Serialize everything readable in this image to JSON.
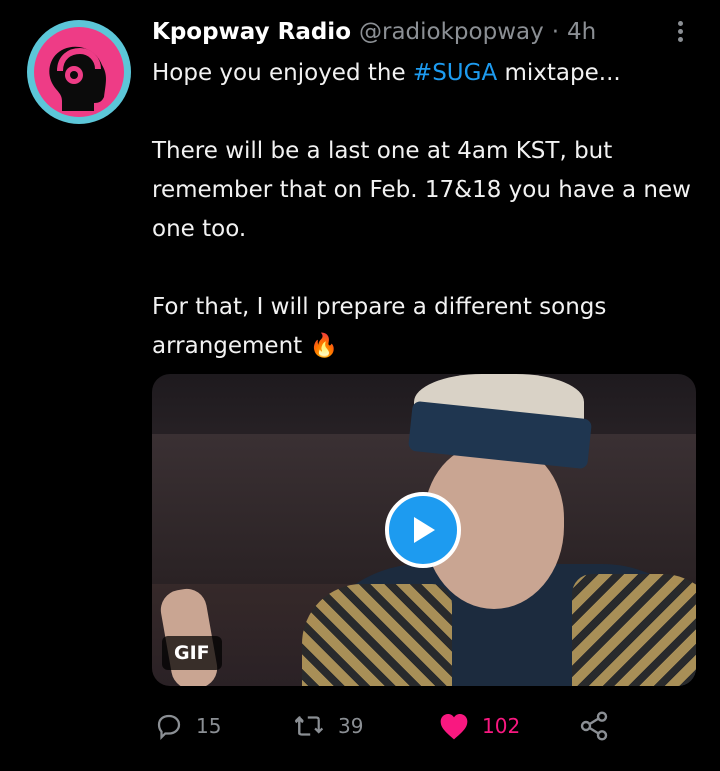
{
  "tweet": {
    "author_name": "Kpopway Radio",
    "handle": "@radiokpopway",
    "separator": "·",
    "time": "4h",
    "line1_prefix": "Hope you enjoyed the ",
    "hashtag": "#SUGA",
    "line1_suffix": " mixtape...",
    "paragraph2": "There will be a last one at 4am KST, but remember that on Feb. 17&18 you have a new one too.",
    "paragraph3": "For that, I will prepare a different songs arrangement",
    "emoji": "🔥"
  },
  "media": {
    "badge": "GIF",
    "play_icon": "play-icon"
  },
  "actions": {
    "replies": "15",
    "retweets": "39",
    "likes": "102",
    "reply_icon": "reply-icon",
    "retweet_icon": "retweet-icon",
    "like_icon": "heart-icon",
    "share_icon": "share-icon"
  },
  "colors": {
    "background": "#000000",
    "text": "#e7e9ea",
    "secondary": "#8b8f94",
    "accent": "#1d9bf0",
    "like": "#f91880",
    "avatar_ring": "#5cc6d8",
    "avatar_fill": "#ee3c86"
  }
}
